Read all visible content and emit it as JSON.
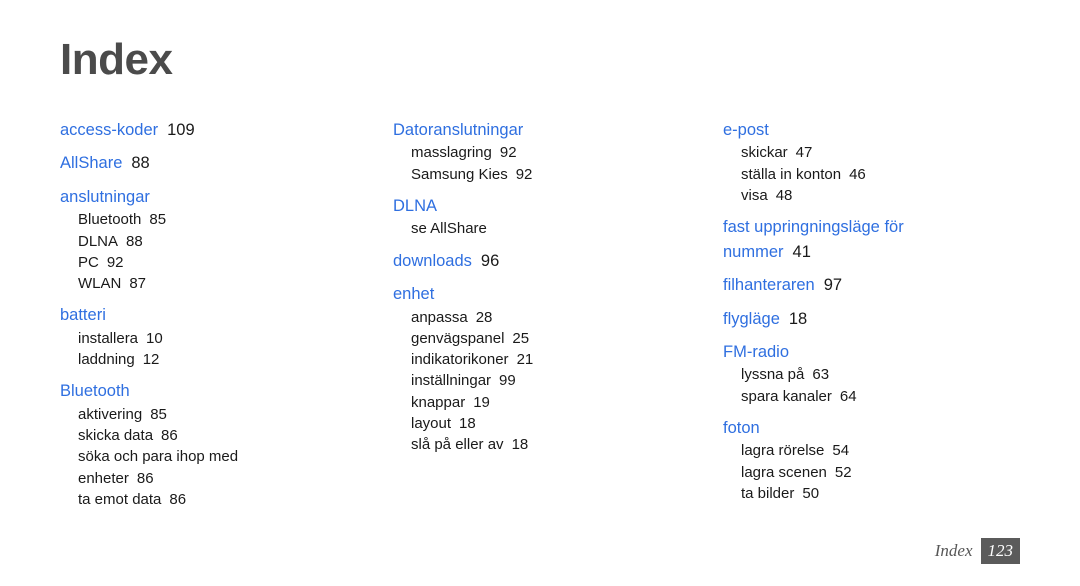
{
  "document": {
    "title": "Index",
    "background_color": "#ffffff",
    "heading_color": "#4b4b4b",
    "entry_color": "#2f6fe0",
    "subentry_color": "#1a1a1a"
  },
  "footer": {
    "label": "Index",
    "page_number": "123",
    "badge_color": "#5b5b5b"
  },
  "columns": [
    {
      "id": "column-1",
      "groups": [
        {
          "head": "access-koder",
          "page": "109",
          "subs": []
        },
        {
          "head": "AllShare",
          "page": "88",
          "subs": []
        },
        {
          "head": "anslutningar",
          "page": "",
          "subs": [
            {
              "label": "Bluetooth",
              "page": "85"
            },
            {
              "label": "DLNA",
              "page": "88"
            },
            {
              "label": "PC",
              "page": "92"
            },
            {
              "label": "WLAN",
              "page": "87"
            }
          ]
        },
        {
          "head": "batteri",
          "page": "",
          "subs": [
            {
              "label": "installera",
              "page": "10"
            },
            {
              "label": "laddning",
              "page": "12"
            }
          ]
        },
        {
          "head": "Bluetooth",
          "page": "",
          "subs": [
            {
              "label": "aktivering",
              "page": "85"
            },
            {
              "label": "skicka data",
              "page": "86"
            },
            {
              "label": "söka och para ihop med enheter",
              "page": "86"
            },
            {
              "label": "ta emot data",
              "page": "86"
            }
          ]
        }
      ]
    },
    {
      "id": "column-2",
      "groups": [
        {
          "head": "Datoranslutningar",
          "page": "",
          "subs": [
            {
              "label": "masslagring",
              "page": "92"
            },
            {
              "label": "Samsung Kies",
              "page": "92"
            }
          ]
        },
        {
          "head": "DLNA",
          "page": "",
          "subs": [
            {
              "label": "se AllShare",
              "page": ""
            }
          ]
        },
        {
          "head": "downloads",
          "page": "96",
          "subs": []
        },
        {
          "head": "enhet",
          "page": "",
          "subs": [
            {
              "label": "anpassa",
              "page": "28"
            },
            {
              "label": "genvägspanel",
              "page": "25"
            },
            {
              "label": "indikatorikoner",
              "page": "21"
            },
            {
              "label": "inställningar",
              "page": "99"
            },
            {
              "label": "knappar",
              "page": "19"
            },
            {
              "label": "layout",
              "page": "18"
            },
            {
              "label": "slå på eller av",
              "page": "18"
            }
          ]
        }
      ]
    },
    {
      "id": "column-3",
      "groups": [
        {
          "head": "e-post",
          "page": "",
          "subs": [
            {
              "label": "skickar",
              "page": "47"
            },
            {
              "label": "ställa in konton",
              "page": "46"
            },
            {
              "label": "visa",
              "page": "48"
            }
          ]
        },
        {
          "head": "fast uppringningsläge för nummer",
          "page": "41",
          "subs": []
        },
        {
          "head": "filhanteraren",
          "page": "97",
          "subs": []
        },
        {
          "head": "flygläge",
          "page": "18",
          "subs": []
        },
        {
          "head": "FM-radio",
          "page": "",
          "subs": [
            {
              "label": "lyssna på",
              "page": "63"
            },
            {
              "label": "spara kanaler",
              "page": "64"
            }
          ]
        },
        {
          "head": "foton",
          "page": "",
          "subs": [
            {
              "label": "lagra rörelse",
              "page": "54"
            },
            {
              "label": "lagra scenen",
              "page": "52"
            },
            {
              "label": "ta bilder",
              "page": "50"
            }
          ]
        }
      ]
    }
  ]
}
